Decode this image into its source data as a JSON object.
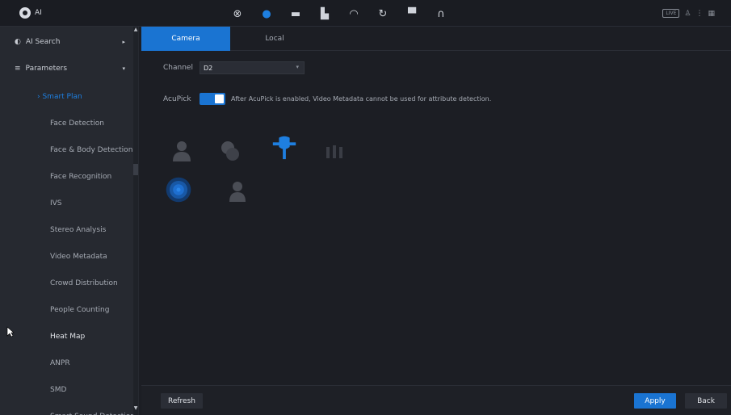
{
  "app": {
    "title": "AI"
  },
  "topnav": [
    {
      "icon": "recording-icon",
      "glyph": "⊗",
      "active": false
    },
    {
      "icon": "ai-icon",
      "glyph": "●",
      "active": true
    },
    {
      "icon": "storage-icon",
      "glyph": "▬",
      "active": false
    },
    {
      "icon": "operation-icon",
      "glyph": "▙",
      "active": false
    },
    {
      "icon": "maintenance-icon",
      "glyph": "◠",
      "active": false
    },
    {
      "icon": "backup-icon",
      "glyph": "↻",
      "active": false
    },
    {
      "icon": "display-icon",
      "glyph": "▀",
      "active": false
    },
    {
      "icon": "audio-icon",
      "glyph": "∩",
      "active": false
    }
  ],
  "topbar_right": {
    "badge": "LIVE"
  },
  "sidebar": {
    "ai_search": "AI Search",
    "parameters": "Parameters",
    "items": [
      {
        "label": "Smart Plan",
        "state": "selected"
      },
      {
        "label": "Face Detection",
        "state": "normal"
      },
      {
        "label": "Face & Body Detection",
        "state": "normal"
      },
      {
        "label": "Face Recognition",
        "state": "normal"
      },
      {
        "label": "IVS",
        "state": "normal"
      },
      {
        "label": "Stereo Analysis",
        "state": "normal"
      },
      {
        "label": "Video Metadata",
        "state": "normal"
      },
      {
        "label": "Crowd Distribution",
        "state": "normal"
      },
      {
        "label": "People Counting",
        "state": "normal"
      },
      {
        "label": "Heat Map",
        "state": "bright"
      },
      {
        "label": "ANPR",
        "state": "normal"
      },
      {
        "label": "SMD",
        "state": "normal"
      },
      {
        "label": "Smart Sound Detection",
        "state": "normal"
      }
    ]
  },
  "tabs": [
    {
      "label": "Camera",
      "active": true
    },
    {
      "label": "Local",
      "active": false
    }
  ],
  "form": {
    "channel_label": "Channel",
    "channel_value": "D2",
    "acupick_label": "AcuPick",
    "acupick_enabled": true,
    "acupick_note": "After AcuPick is enabled, Video Metadata cannot be used for attribute detection."
  },
  "function_icons": [
    {
      "icon": "face-detection-icon",
      "color": "#4a4d55"
    },
    {
      "icon": "face-recognition-icon",
      "color": "#4a4d55"
    },
    {
      "icon": "ivs-icon",
      "color": "#1e7fe0"
    },
    {
      "icon": "people-counting-icon",
      "color": "#3a3d45"
    },
    {
      "icon": "heat-map-icon",
      "color": "#1e6fd0"
    },
    {
      "icon": "smd-icon",
      "color": "#4a4d55"
    }
  ],
  "buttons": {
    "refresh": "Refresh",
    "apply": "Apply",
    "back": "Back"
  },
  "colors": {
    "accent": "#1a74d2",
    "background": "#1c1e24",
    "sidebar": "#262930"
  }
}
